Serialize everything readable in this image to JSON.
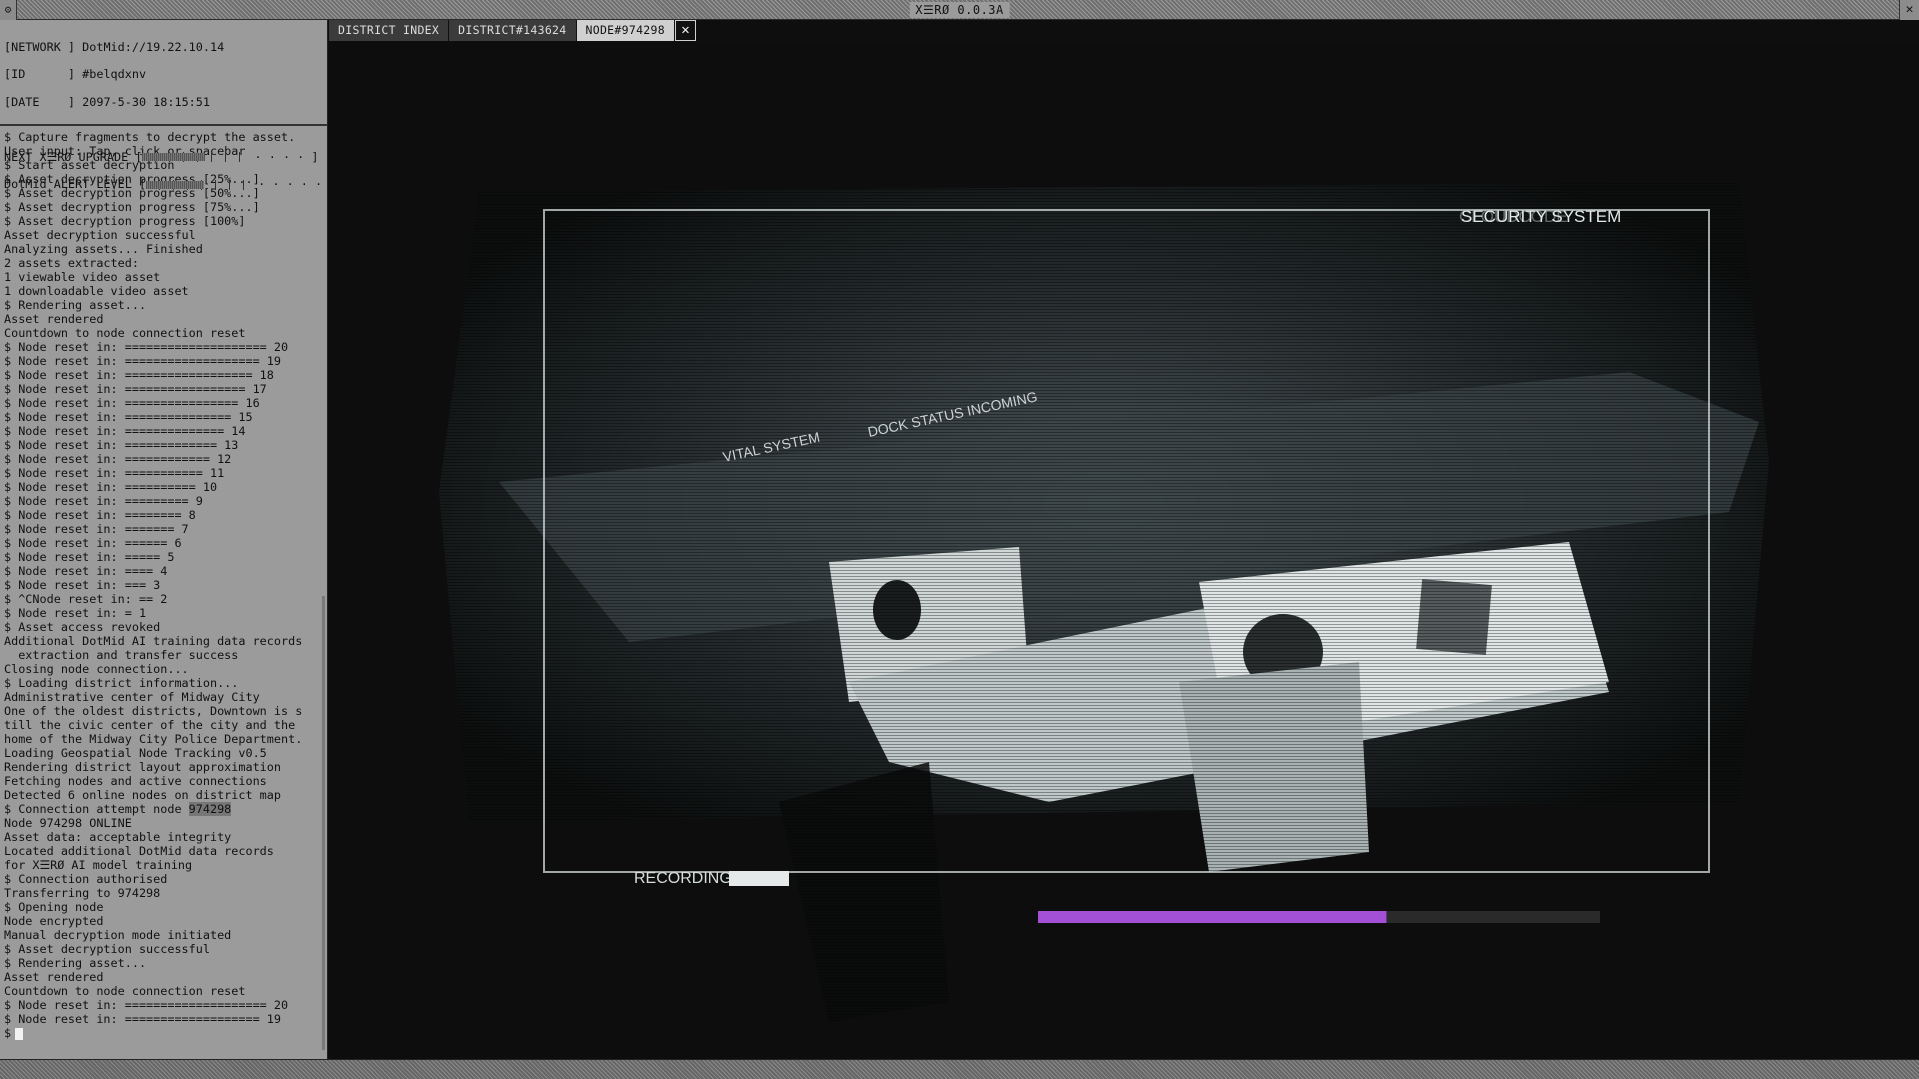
{
  "window": {
    "title": "X☰RØ 0.0.3A",
    "menu_icon": "gear-icon",
    "close_glyph": "✕"
  },
  "status": {
    "network_label": "[NETWORK ]",
    "network_value": "DotMid://19.22.10.14",
    "id_label": "[ID      ]",
    "id_value": "#belqdxnv",
    "date_label": "[DATE    ]",
    "date_value": "2097-5-30 18:15:51",
    "upgrade_label": "NEXT X☰RØ UPGRADE",
    "upgrade_level": 0.6,
    "alert_label": "DotMid ALERT LEVEL",
    "alert_level": 0.55
  },
  "log": {
    "lines": [
      "$ Capture fragments to decrypt the asset.",
      "User input: Tap, click or spacebar",
      "$ Start asset decryption",
      "$ Asset decryption progress [25%...]",
      "$ Asset decryption progress [50%...]",
      "$ Asset decryption progress [75%...]",
      "$ Asset decryption progress [100%]",
      "Asset decryption successful",
      "Analyzing assets... Finished",
      "2 assets extracted:",
      "1 viewable video asset",
      "1 downloadable video asset",
      "$ Rendering asset...",
      "Asset rendered",
      "Countdown to node connection reset",
      "$ Node reset in: ==================== 20",
      "$ Node reset in: =================== 19",
      "$ Node reset in: ================== 18",
      "$ Node reset in: ================= 17",
      "$ Node reset in: ================ 16",
      "$ Node reset in: =============== 15",
      "$ Node reset in: ============== 14",
      "$ Node reset in: ============= 13",
      "$ Node reset in: ============ 12",
      "$ Node reset in: =========== 11",
      "$ Node reset in: ========== 10",
      "$ Node reset in: ========= 9",
      "$ Node reset in: ======== 8",
      "$ Node reset in: ======= 7",
      "$ Node reset in: ====== 6",
      "$ Node reset in: ===== 5",
      "$ Node reset in: ==== 4",
      "$ Node reset in: === 3",
      "$ ^CNode reset in: == 2",
      "$ Node reset in: = 1",
      "$ Asset access revoked",
      "Additional DotMid AI training data records",
      "  extraction and transfer success",
      "Closing node connection...",
      "$ Loading district information...",
      "Administrative center of Midway City",
      "One of the oldest districts, Downtown is s",
      "till the civic center of the city and the",
      "home of the Midway City Police Department.",
      "Loading Geospatial Node Tracking v0.5",
      "Rendering district layout approximation",
      "Fetching nodes and active connections",
      "Detected 6 online nodes on district map"
    ],
    "attempt_prefix": "$ Connection attempt node ",
    "attempt_node": "974298",
    "lines2": [
      "Node 974298 ONLINE",
      "Asset data: acceptable integrity",
      "Located additional DotMid data records",
      "for X☰RØ AI model training",
      "$ Connection authorised",
      "Transferring to 974298",
      "$ Opening node",
      "Node encrypted",
      "Manual decryption mode initiated",
      "$ Asset decryption successful",
      "$ Rendering asset...",
      "Asset rendered",
      "Countdown to node connection reset",
      "$ Node reset in: ==================== 20",
      "$ Node reset in: =================== 19"
    ],
    "prompt": "$"
  },
  "tabs": [
    {
      "label": "DISTRICT INDEX",
      "active": false
    },
    {
      "label": "DISTRICT#143624",
      "active": false
    },
    {
      "label": "NODE#974298",
      "active": true
    }
  ],
  "tab_close_glyph": "✕",
  "video": {
    "overlay_title": "SECURITY SYSTEM",
    "overlay_faded": "CLOUDCODE",
    "sign_left": "VITAL SYSTEM",
    "sign_right": "DOCK STATUS INCOMING",
    "recording_label": "RECORDING",
    "progress": 0.62,
    "progress_color": "#a34fd6"
  }
}
